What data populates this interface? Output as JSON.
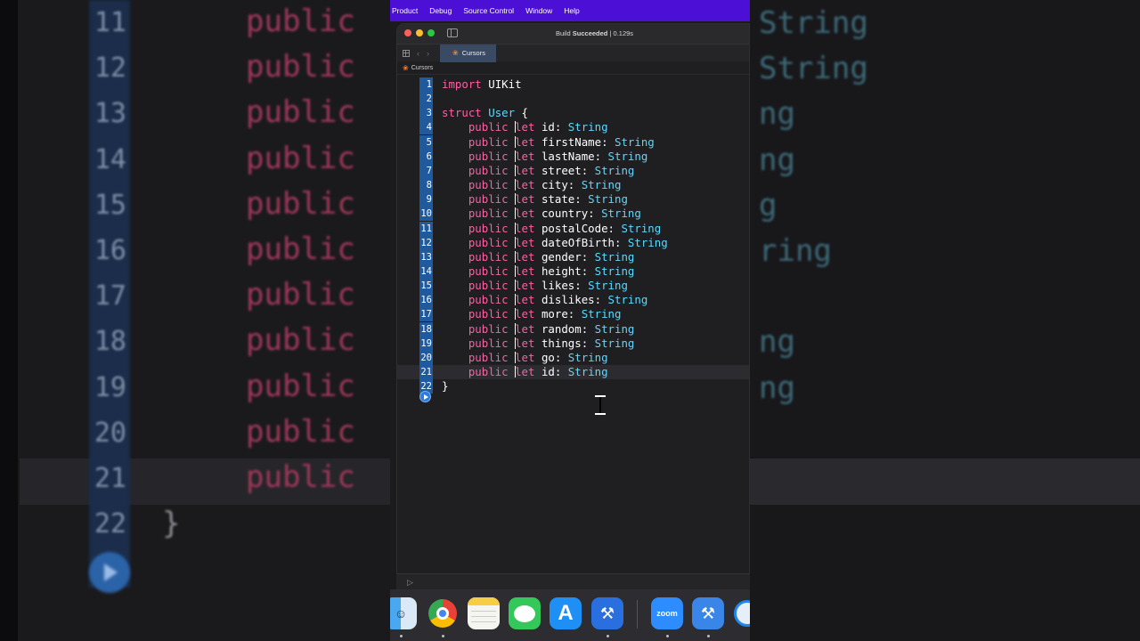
{
  "menubar": {
    "items": [
      "Product",
      "Debug",
      "Source Control",
      "Window",
      "Help"
    ]
  },
  "window": {
    "status_prefix": "Build",
    "status_bold": "Succeeded",
    "status_time": "| 0.129s"
  },
  "tab": {
    "label": "Cursors",
    "icon": "swift-icon"
  },
  "path": {
    "label": "Cursors"
  },
  "code": {
    "line1": {
      "num": "1",
      "kw": "import",
      "name": "UIKit"
    },
    "line2": {
      "num": "2"
    },
    "line3": {
      "num": "3",
      "kw": "struct",
      "name": "User",
      "brace": "{"
    },
    "props": [
      {
        "num": "4",
        "name": "id"
      },
      {
        "num": "5",
        "name": "firstName"
      },
      {
        "num": "6",
        "name": "lastName"
      },
      {
        "num": "7",
        "name": "street"
      },
      {
        "num": "8",
        "name": "city"
      },
      {
        "num": "9",
        "name": "state"
      },
      {
        "num": "10",
        "name": "country"
      },
      {
        "num": "11",
        "name": "postalCode"
      },
      {
        "num": "12",
        "name": "dateOfBirth"
      },
      {
        "num": "13",
        "name": "gender"
      },
      {
        "num": "14",
        "name": "height"
      },
      {
        "num": "15",
        "name": "likes"
      },
      {
        "num": "16",
        "name": "dislikes"
      },
      {
        "num": "17",
        "name": "more"
      },
      {
        "num": "18",
        "name": "random"
      },
      {
        "num": "19",
        "name": "things"
      },
      {
        "num": "20",
        "name": "go"
      },
      {
        "num": "21",
        "name": "id"
      }
    ],
    "access": "public",
    "decl": "let",
    "type": "String",
    "closing": {
      "num": "22",
      "brace": "}"
    }
  },
  "background": {
    "numbers": [
      "11",
      "12",
      "13",
      "14",
      "15",
      "16",
      "17",
      "18",
      "19",
      "20",
      "21",
      "22"
    ],
    "keyword": "public",
    "right_fragments": [
      "String",
      "String",
      "ng",
      "ng",
      "g",
      "ring",
      "",
      "ng",
      "ng"
    ],
    "brace": "}"
  },
  "dock": {
    "apps": [
      "finder-icon",
      "chrome-icon",
      "notes-icon",
      "messages-icon",
      "app-store-icon",
      "xcode-icon",
      "zoom-icon",
      "xcode-beta-icon",
      "safari-icon"
    ],
    "zoom_label": "zoom"
  },
  "colors": {
    "menubar": "#4b0fd6",
    "keyword": "#fc5fa3",
    "type": "#5dd8ff",
    "line_number_bg": "#1f5a9e"
  }
}
